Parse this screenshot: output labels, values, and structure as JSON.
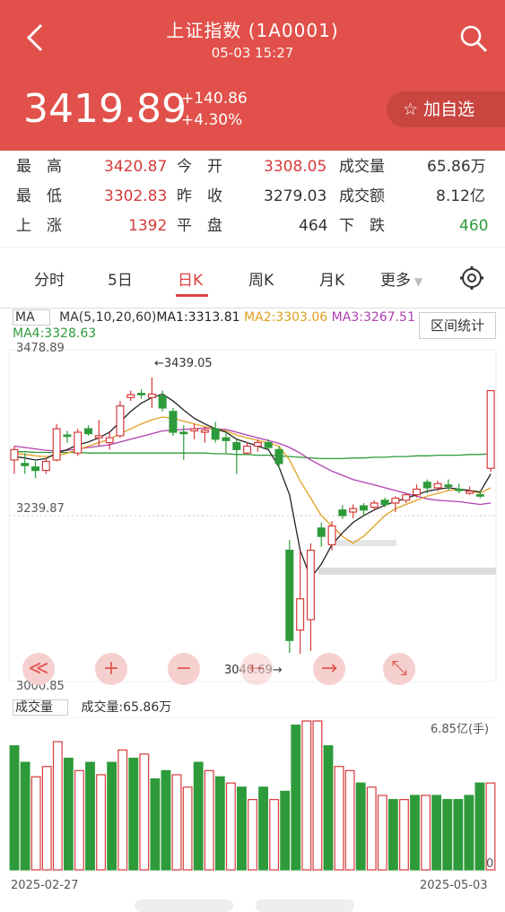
{
  "header": {
    "title": "上证指数 (1A0001)",
    "datetime": "05-03 15:27",
    "price": "3419.89",
    "change": "+140.86",
    "change_pct": "+4.30%",
    "fav_label": "加自选",
    "fav_icon": "star-icon",
    "back_icon": "chevron-left-icon",
    "search_icon": "search-icon",
    "bg_color": "#e1504a"
  },
  "stats": {
    "row1": [
      {
        "label": "最　高",
        "value": "3420.87",
        "color": "red"
      },
      {
        "label": "今　开",
        "value": "3308.05",
        "color": "red"
      },
      {
        "label": "成交量",
        "value": "65.86万",
        "color": "plain"
      }
    ],
    "row2": [
      {
        "label": "最　低",
        "value": "3302.83",
        "color": "red"
      },
      {
        "label": "昨　收",
        "value": "3279.03",
        "color": "plain"
      },
      {
        "label": "成交额",
        "value": "8.12亿",
        "color": "plain"
      }
    ],
    "row3": [
      {
        "label": "上　涨",
        "value": "1392",
        "color": "red"
      },
      {
        "label": "平　盘",
        "value": "464",
        "color": "plain"
      },
      {
        "label": "下　跌",
        "value": "460",
        "color": "green"
      }
    ]
  },
  "tabs": [
    "分时",
    "5日",
    "日K",
    "周K",
    "月K",
    "更多"
  ],
  "active_tab": "日K",
  "settings_icon": "gear-icon",
  "ma": {
    "selector": "MA",
    "params": "MA(5,10,20,60)",
    "ma1": "MA1:3313.81",
    "ma2": "MA2:3303.06",
    "ma3": "MA3:3267.51",
    "ma4": "MA4:3328.63",
    "range_button": "区间统计"
  },
  "chart": {
    "y_high": "3478.89",
    "y_mid": "3239.87",
    "y_low": "3000.85",
    "annot_high": "←3439.05",
    "annot_low": "3040.69→",
    "colors": {
      "up": "#d63a3a",
      "down": "#2e9b3b",
      "ma1": "#222222",
      "ma2": "#e0a020",
      "ma3": "#b040b0",
      "ma4": "#2e9b3b"
    }
  },
  "controls": [
    {
      "name": "scroll-left-fast-icon",
      "glyph": "≪"
    },
    {
      "name": "zoom-in-icon",
      "glyph": "+"
    },
    {
      "name": "zoom-out-icon",
      "glyph": "−"
    },
    {
      "name": "scroll-left-icon",
      "glyph": "←"
    },
    {
      "name": "scroll-right-icon",
      "glyph": "→"
    },
    {
      "name": "fullscreen-icon",
      "glyph": "⤡"
    }
  ],
  "volume": {
    "selector": "成交量",
    "label": "成交量:65.86万",
    "max_label": "6.85亿(手)",
    "zero_label": "0"
  },
  "dates": {
    "start": "2025-02-27",
    "end": "2025-05-03"
  },
  "chart_data": {
    "type": "candlestick",
    "y_range": [
      3000.85,
      3478.89
    ],
    "candles": [
      {
        "o": 3320,
        "h": 3340,
        "l": 3300,
        "c": 3335,
        "up": true
      },
      {
        "o": 3315,
        "h": 3330,
        "l": 3300,
        "c": 3312,
        "up": false
      },
      {
        "o": 3305,
        "h": 3318,
        "l": 3294,
        "c": 3310,
        "up": false
      },
      {
        "o": 3305,
        "h": 3322,
        "l": 3300,
        "c": 3318,
        "up": true
      },
      {
        "o": 3320,
        "h": 3372,
        "l": 3318,
        "c": 3365,
        "up": true
      },
      {
        "o": 3355,
        "h": 3362,
        "l": 3345,
        "c": 3356,
        "up": false
      },
      {
        "o": 3330,
        "h": 3365,
        "l": 3326,
        "c": 3360,
        "up": true
      },
      {
        "o": 3365,
        "h": 3370,
        "l": 3355,
        "c": 3358,
        "up": false
      },
      {
        "o": 3352,
        "h": 3378,
        "l": 3340,
        "c": 3355,
        "up": true
      },
      {
        "o": 3345,
        "h": 3360,
        "l": 3335,
        "c": 3352,
        "up": true
      },
      {
        "o": 3355,
        "h": 3405,
        "l": 3352,
        "c": 3398,
        "up": true
      },
      {
        "o": 3410,
        "h": 3420,
        "l": 3405,
        "c": 3414,
        "up": true
      },
      {
        "o": 3414,
        "h": 3422,
        "l": 3408,
        "c": 3416,
        "up": false
      },
      {
        "o": 3410,
        "h": 3439,
        "l": 3395,
        "c": 3415,
        "up": true
      },
      {
        "o": 3412,
        "h": 3420,
        "l": 3390,
        "c": 3395,
        "up": false
      },
      {
        "o": 3390,
        "h": 3395,
        "l": 3355,
        "c": 3360,
        "up": false
      },
      {
        "o": 3360,
        "h": 3370,
        "l": 3320,
        "c": 3358,
        "up": false
      },
      {
        "o": 3365,
        "h": 3372,
        "l": 3350,
        "c": 3362,
        "up": true
      },
      {
        "o": 3360,
        "h": 3368,
        "l": 3345,
        "c": 3363,
        "up": true
      },
      {
        "o": 3365,
        "h": 3375,
        "l": 3345,
        "c": 3350,
        "up": false
      },
      {
        "o": 3348,
        "h": 3360,
        "l": 3330,
        "c": 3352,
        "up": false
      },
      {
        "o": 3345,
        "h": 3350,
        "l": 3300,
        "c": 3335,
        "up": false
      },
      {
        "o": 3330,
        "h": 3345,
        "l": 3328,
        "c": 3340,
        "up": true
      },
      {
        "o": 3340,
        "h": 3350,
        "l": 3332,
        "c": 3345,
        "up": true
      },
      {
        "o": 3345,
        "h": 3350,
        "l": 3335,
        "c": 3338,
        "up": false
      },
      {
        "o": 3335,
        "h": 3340,
        "l": 3308,
        "c": 3315,
        "up": false
      },
      {
        "o": 3190,
        "h": 3205,
        "l": 3042,
        "c": 3060,
        "up": false
      },
      {
        "o": 3075,
        "h": 3190,
        "l": 3041,
        "c": 3120,
        "up": true
      },
      {
        "o": 3090,
        "h": 3200,
        "l": 3045,
        "c": 3190,
        "up": true
      },
      {
        "o": 3210,
        "h": 3230,
        "l": 3195,
        "c": 3222,
        "up": false
      },
      {
        "o": 3198,
        "h": 3232,
        "l": 3190,
        "c": 3225,
        "up": true
      },
      {
        "o": 3240,
        "h": 3255,
        "l": 3235,
        "c": 3248,
        "up": false
      },
      {
        "o": 3245,
        "h": 3256,
        "l": 3236,
        "c": 3250,
        "up": true
      },
      {
        "o": 3248,
        "h": 3258,
        "l": 3240,
        "c": 3254,
        "up": false
      },
      {
        "o": 3252,
        "h": 3262,
        "l": 3248,
        "c": 3258,
        "up": true
      },
      {
        "o": 3256,
        "h": 3266,
        "l": 3252,
        "c": 3262,
        "up": false
      },
      {
        "o": 3258,
        "h": 3268,
        "l": 3245,
        "c": 3265,
        "up": true
      },
      {
        "o": 3262,
        "h": 3272,
        "l": 3258,
        "c": 3270,
        "up": true
      },
      {
        "o": 3270,
        "h": 3285,
        "l": 3266,
        "c": 3278,
        "up": true
      },
      {
        "o": 3280,
        "h": 3292,
        "l": 3272,
        "c": 3288,
        "up": false
      },
      {
        "o": 3280,
        "h": 3290,
        "l": 3275,
        "c": 3286,
        "up": true
      },
      {
        "o": 3284,
        "h": 3292,
        "l": 3276,
        "c": 3282,
        "up": false
      },
      {
        "o": 3278,
        "h": 3286,
        "l": 3272,
        "c": 3276,
        "up": false
      },
      {
        "o": 3275,
        "h": 3282,
        "l": 3270,
        "c": 3272,
        "up": true
      },
      {
        "o": 3270,
        "h": 3276,
        "l": 3265,
        "c": 3268,
        "up": false
      },
      {
        "o": 3308,
        "h": 3421,
        "l": 3303,
        "c": 3420,
        "up": true
      }
    ],
    "volume": [
      {
        "v": 0.6,
        "up": false
      },
      {
        "v": 0.52,
        "up": false
      },
      {
        "v": 0.45,
        "up": true
      },
      {
        "v": 0.5,
        "up": true
      },
      {
        "v": 0.62,
        "up": true
      },
      {
        "v": 0.54,
        "up": false
      },
      {
        "v": 0.48,
        "up": true
      },
      {
        "v": 0.52,
        "up": false
      },
      {
        "v": 0.46,
        "up": true
      },
      {
        "v": 0.52,
        "up": false
      },
      {
        "v": 0.58,
        "up": true
      },
      {
        "v": 0.54,
        "up": false
      },
      {
        "v": 0.56,
        "up": true
      },
      {
        "v": 0.44,
        "up": false
      },
      {
        "v": 0.48,
        "up": false
      },
      {
        "v": 0.46,
        "up": true
      },
      {
        "v": 0.4,
        "up": true
      },
      {
        "v": 0.52,
        "up": false
      },
      {
        "v": 0.48,
        "up": true
      },
      {
        "v": 0.45,
        "up": false
      },
      {
        "v": 0.42,
        "up": true
      },
      {
        "v": 0.4,
        "up": false
      },
      {
        "v": 0.34,
        "up": true
      },
      {
        "v": 0.4,
        "up": false
      },
      {
        "v": 0.34,
        "up": true
      },
      {
        "v": 0.38,
        "up": false
      },
      {
        "v": 0.7,
        "up": false
      },
      {
        "v": 0.72,
        "up": true
      },
      {
        "v": 0.72,
        "up": true
      },
      {
        "v": 0.6,
        "up": false
      },
      {
        "v": 0.5,
        "up": true
      },
      {
        "v": 0.48,
        "up": true
      },
      {
        "v": 0.42,
        "up": false
      },
      {
        "v": 0.4,
        "up": true
      },
      {
        "v": 0.36,
        "up": true
      },
      {
        "v": 0.34,
        "up": false
      },
      {
        "v": 0.34,
        "up": true
      },
      {
        "v": 0.36,
        "up": false
      },
      {
        "v": 0.36,
        "up": true
      },
      {
        "v": 0.36,
        "up": false
      },
      {
        "v": 0.34,
        "up": false
      },
      {
        "v": 0.34,
        "up": false
      },
      {
        "v": 0.36,
        "up": false
      },
      {
        "v": 0.42,
        "up": false
      },
      {
        "v": 0.42,
        "up": true
      }
    ],
    "ma1": [
      3325,
      3323,
      3320,
      3322,
      3330,
      3335,
      3342,
      3346,
      3352,
      3360,
      3375,
      3390,
      3402,
      3410,
      3415,
      3405,
      3392,
      3380,
      3372,
      3365,
      3360,
      3350,
      3345,
      3340,
      3335,
      3310,
      3270,
      3190,
      3150,
      3170,
      3198,
      3215,
      3230,
      3240,
      3248,
      3255,
      3260,
      3265,
      3270,
      3275,
      3278,
      3280,
      3278,
      3276,
      3274,
      3300
    ],
    "ma2": [
      3330,
      3328,
      3326,
      3325,
      3326,
      3330,
      3335,
      3340,
      3345,
      3350,
      3358,
      3365,
      3372,
      3378,
      3382,
      3380,
      3376,
      3372,
      3368,
      3365,
      3362,
      3356,
      3352,
      3348,
      3345,
      3340,
      3320,
      3290,
      3265,
      3240,
      3225,
      3210,
      3200,
      3210,
      3225,
      3240,
      3250,
      3256,
      3262,
      3268,
      3272,
      3276,
      3278,
      3276,
      3272,
      3280
    ],
    "ma3": [
      3340,
      3338,
      3336,
      3334,
      3333,
      3334,
      3336,
      3338,
      3340,
      3342,
      3346,
      3350,
      3354,
      3358,
      3362,
      3363,
      3364,
      3365,
      3366,
      3365,
      3364,
      3360,
      3356,
      3352,
      3348,
      3344,
      3338,
      3330,
      3320,
      3312,
      3304,
      3298,
      3292,
      3288,
      3284,
      3280,
      3276,
      3272,
      3268,
      3264,
      3262,
      3261,
      3260,
      3258,
      3256,
      3258
    ],
    "ma4": [
      3332,
      3332,
      3331,
      3331,
      3331,
      3331,
      3331,
      3330,
      3330,
      3330,
      3330,
      3330,
      3330,
      3330,
      3330,
      3330,
      3330,
      3330,
      3330,
      3329,
      3329,
      3328,
      3328,
      3327,
      3327,
      3326,
      3325,
      3324,
      3323,
      3322,
      3322,
      3322,
      3323,
      3323,
      3324,
      3324,
      3325,
      3325,
      3326,
      3326,
      3327,
      3327,
      3327,
      3328,
      3328,
      3329
    ]
  }
}
